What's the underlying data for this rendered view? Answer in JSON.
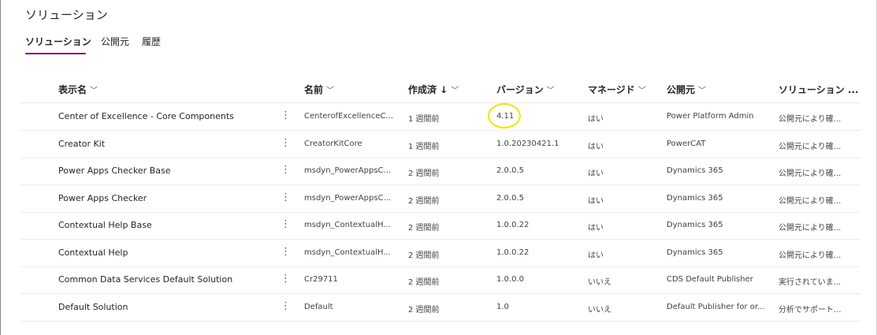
{
  "header": {
    "title": "ソリューション"
  },
  "tabs": [
    {
      "label": "ソリューション",
      "active": true
    },
    {
      "label": "公開元",
      "active": false
    },
    {
      "label": "履歴",
      "active": false
    }
  ],
  "columns": [
    {
      "label": "表示名",
      "icon": "chevron-down-icon"
    },
    {
      "label": "名前",
      "icon": "chevron-down-icon"
    },
    {
      "label": "作成済 ↓",
      "icon": "chevron-down-icon"
    },
    {
      "label": "バージョン",
      "icon": "chevron-down-icon"
    },
    {
      "label": "マネージド",
      "icon": "chevron-down-icon"
    },
    {
      "label": "公開元",
      "icon": "chevron-down-icon"
    },
    {
      "label": "ソリューション ..."
    }
  ],
  "rows": [
    {
      "display_name": "Center of Excellence - Core Components",
      "name": "CenterofExcellenceC...",
      "created": "1 週間前",
      "version": "4.11",
      "managed": "はい",
      "publisher": "Power Platform Admin",
      "status": "公開元により確..."
    },
    {
      "display_name": "Creator Kit",
      "name": "CreatorKitCore",
      "created": "1 週間前",
      "version": "1.0.20230421.1",
      "managed": "はい",
      "publisher": "PowerCAT",
      "status": "公開元により確..."
    },
    {
      "display_name": "Power Apps Checker Base",
      "name": "msdyn_PowerAppsC...",
      "created": "2 週間前",
      "version": "2.0.0.5",
      "managed": "はい",
      "publisher": "Dynamics 365",
      "status": "公開元により確..."
    },
    {
      "display_name": "Power Apps Checker",
      "name": "msdyn_PowerAppsC...",
      "created": "2 週間前",
      "version": "2.0.0.5",
      "managed": "はい",
      "publisher": "Dynamics 365",
      "status": "公開元により確..."
    },
    {
      "display_name": "Contextual Help Base",
      "name": "msdyn_ContextualH...",
      "created": "2 週間前",
      "version": "1.0.0.22",
      "managed": "はい",
      "publisher": "Dynamics 365",
      "status": "公開元により確..."
    },
    {
      "display_name": "Contextual Help",
      "name": "msdyn_ContextualH...",
      "created": "2 週間前",
      "version": "1.0.0.22",
      "managed": "はい",
      "publisher": "Dynamics 365",
      "status": "公開元により確..."
    },
    {
      "display_name": "Common Data Services Default Solution",
      "name": "Cr29711",
      "created": "2 週間前",
      "version": "1.0.0.0",
      "managed": "いいえ",
      "publisher": "CDS Default Publisher",
      "status": "実行されていま..."
    },
    {
      "display_name": "Default Solution",
      "name": "Default",
      "created": "2 週間前",
      "version": "1.0",
      "managed": "いいえ",
      "publisher": "Default Publisher for or...",
      "status": "分析でサポート..."
    }
  ],
  "row_menu_glyph": "⋮",
  "colors": {
    "accent": "#742774",
    "highlight": "#f2e500"
  }
}
